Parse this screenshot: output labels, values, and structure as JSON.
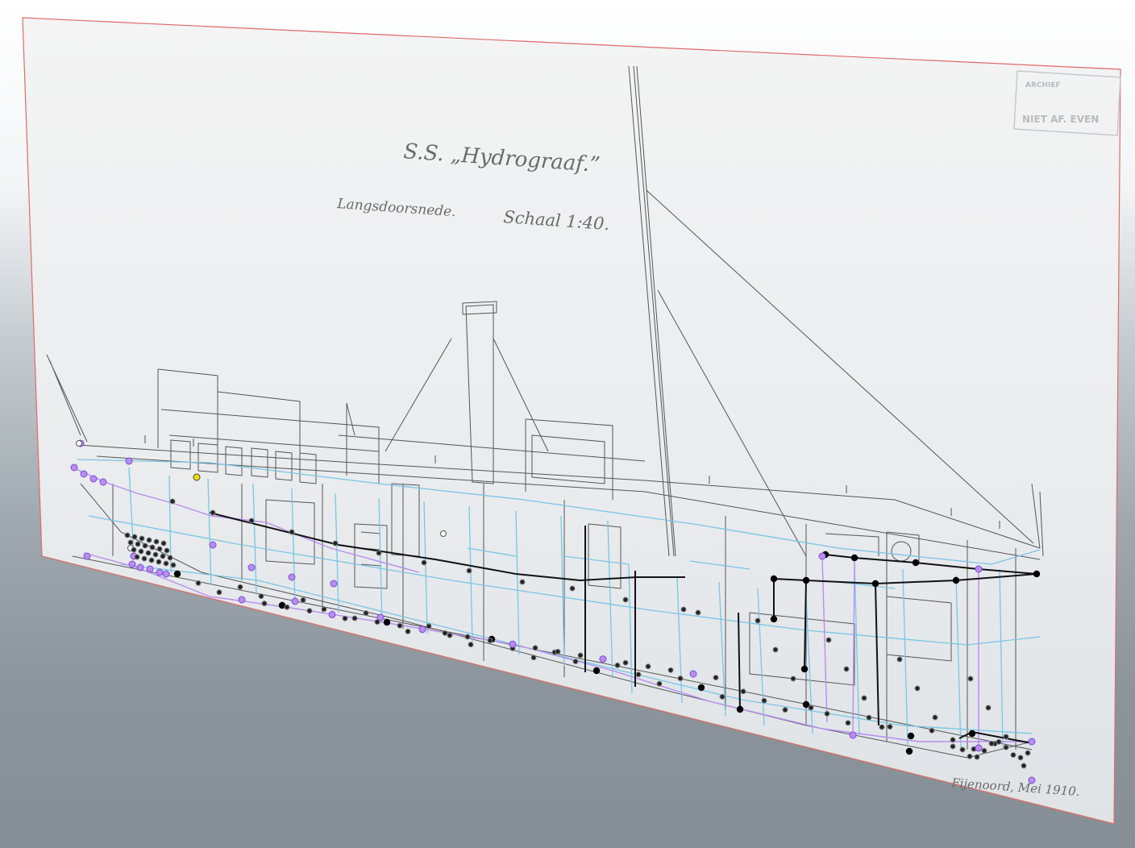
{
  "drawing": {
    "title": "S.S. „Hydrograaf.”",
    "subtitle": "Langsdoorsnede.",
    "scale": "Schaal 1:40.",
    "signature": "Fijenoord, Mei 1910.",
    "stamp_lines": [
      "ARCHIEF",
      "NIET AF. EVEN"
    ]
  },
  "colors": {
    "plane_border": "#e06a6a",
    "blueprint_ink": "#555555",
    "station_lines": "#78c6e6",
    "curve_purple": "#b98cf0",
    "control_point_dark": "#222222",
    "selected_point": "#e8e000",
    "background_top": "#ffffff",
    "background_bottom": "#858f95"
  },
  "scene": {
    "object": "reference-image-plane",
    "mode": "3d-perspective-viewport"
  }
}
